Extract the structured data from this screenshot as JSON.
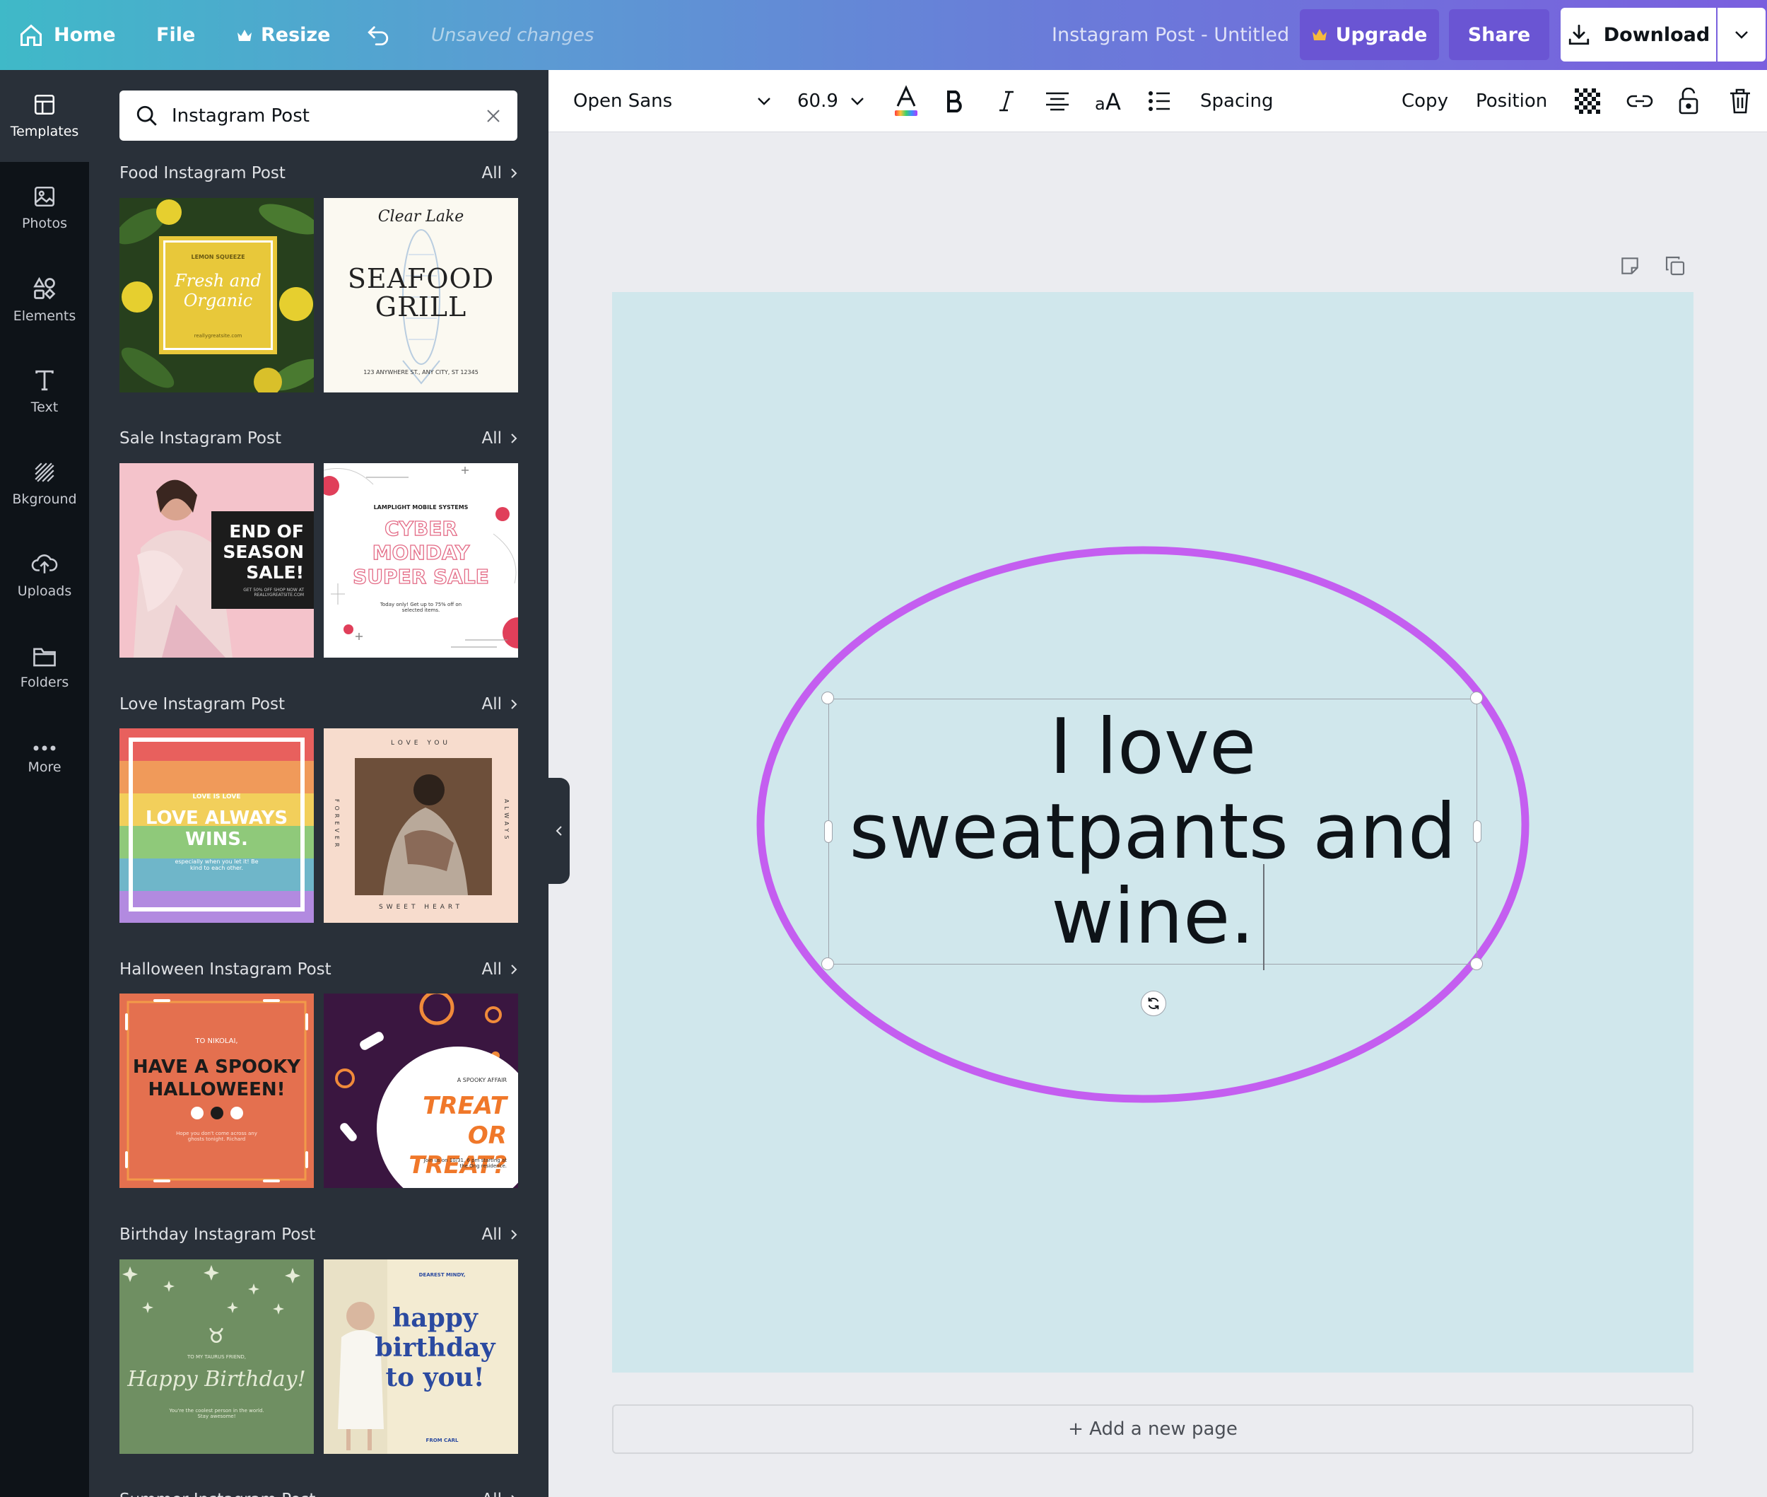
{
  "topbar": {
    "home": "Home",
    "file": "File",
    "resize": "Resize",
    "unsaved": "Unsaved changes",
    "doc_title": "Instagram Post - Untitled",
    "upgrade": "Upgrade",
    "share": "Share",
    "download": "Download"
  },
  "rail": [
    {
      "label": "Templates",
      "icon": "templates-icon",
      "active": true
    },
    {
      "label": "Photos",
      "icon": "photos-icon"
    },
    {
      "label": "Elements",
      "icon": "elements-icon"
    },
    {
      "label": "Text",
      "icon": "text-icon"
    },
    {
      "label": "Bkground",
      "icon": "background-icon"
    },
    {
      "label": "Uploads",
      "icon": "uploads-icon"
    },
    {
      "label": "Folders",
      "icon": "folders-icon"
    },
    {
      "label": "More",
      "icon": "more-icon"
    }
  ],
  "search": {
    "value": "Instagram Post"
  },
  "sections": [
    {
      "title": "Food Instagram Post",
      "all": "All"
    },
    {
      "title": "Sale Instagram Post",
      "all": "All"
    },
    {
      "title": "Love Instagram Post",
      "all": "All"
    },
    {
      "title": "Halloween Instagram Post",
      "all": "All"
    },
    {
      "title": "Birthday Instagram Post",
      "all": "All"
    },
    {
      "title": "Summer Instagram Post",
      "all": "All"
    }
  ],
  "templates": {
    "food1": {
      "brand": "LEMON SQUEEZE",
      "title": "Fresh and Organic",
      "url": "reallygreatsite.com"
    },
    "food2": {
      "script": "Clear Lake",
      "title1": "SEAFOOD",
      "title2": "GRILL",
      "address": "123 ANYWHERE ST., ANY CITY, ST 12345"
    },
    "sale1": {
      "l1": "END OF",
      "l2": "SEASON",
      "l3": "SALE!",
      "small": "GET 50% OFF SHOP NOW AT REALLYGREATSITE.COM"
    },
    "sale2": {
      "brand": "LAMPLIGHT MOBILE SYSTEMS",
      "l1": "CYBER",
      "l2": "MONDAY",
      "l3": "SUPER SALE",
      "small": "Today only! Get up to 75% off on selected items."
    },
    "love1": {
      "small": "LOVE IS LOVE",
      "l1": "LOVE ALWAYS",
      "l2": "WINS.",
      "sub": "especially when you let it! Be kind to each other."
    },
    "love2": {
      "top": "LOVE YOU",
      "left": "FOREVER",
      "right": "ALWAYS",
      "bottom": "SWEET HEART"
    },
    "hall1": {
      "to": "TO NIKOLAI,",
      "l1": "HAVE A SPOOKY",
      "l2": "HALLOWEEN!",
      "sub": "Hope you don't come across any ghosts tonight. Richard"
    },
    "hall2": {
      "small": "A SPOOKY AFFAIR",
      "l1": "TREAT OR",
      "l2": "TREAT?",
      "sub": "Join us on 10/31, 6 pm starting at the Ong residence."
    },
    "bday1": {
      "to": "TO MY TAURUS FRIEND,",
      "title": "Happy Birthday!",
      "sub": "You're the coolest person in the world. Stay awesome!"
    },
    "bday2": {
      "top": "DEAREST MINDY,",
      "l1": "happy",
      "l2": "birthday",
      "l3": "to you!",
      "from": "FROM CARL"
    }
  },
  "toolbar": {
    "font": "Open Sans",
    "size": "60.9",
    "spacing": "Spacing",
    "copy": "Copy",
    "position": "Position"
  },
  "canvas": {
    "text_lines": [
      "I love",
      "sweatpants and",
      "wine."
    ],
    "add_page": "+ Add a new page",
    "background": "#d0e7ec",
    "ellipse_color": "#c45ef0"
  }
}
